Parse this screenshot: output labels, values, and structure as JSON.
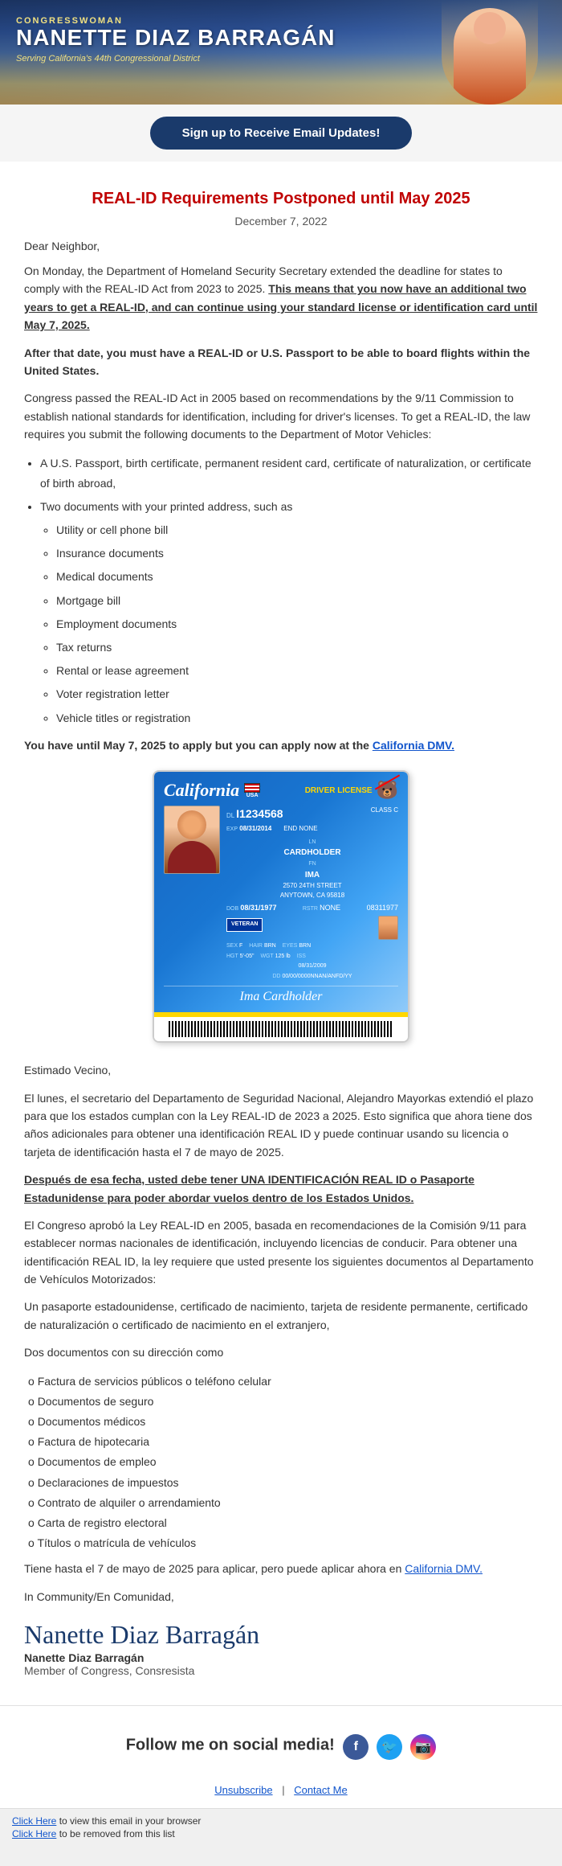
{
  "header": {
    "congresswoman_label": "CONGRESSWOMAN",
    "name": "NANETTE DIAZ BARRAGÁN",
    "district": "Serving California's 44th Congressional District"
  },
  "signup": {
    "button_label": "Sign up to Receive Email Updates!"
  },
  "article": {
    "title": "REAL-ID Requirements Postponed until May 2025",
    "date": "December 7, 2022",
    "greeting": "Dear Neighbor,",
    "para1": "On Monday,  the Department of Homeland Security Secretary extended the deadline for states to comply with the REAL-ID Act from 2023 to 2025.",
    "para1_strong": "This means that you now have an additional two years to get a REAL-ID, and can continue using your standard license or identification card until May 7, 2025.",
    "para2_bold": "After that date, you must have a REAL-ID or U.S. Passport to be able to board flights within the United States.",
    "para3": "Congress passed the REAL-ID Act in 2005 based on recommendations by the 9/11 Commission to establish national standards for identification, including for driver's licenses. To get a REAL-ID, the law requires you submit the following documents to the Department of Motor Vehicles:",
    "list1_item1": "A U.S. Passport, birth certificate, permanent resident card, certificate of naturalization, or certificate of birth abroad,",
    "list1_item2": "Two documents with your printed address, such as",
    "sublist": [
      "Utility or cell phone bill",
      "Insurance documents",
      "Medical documents",
      "Mortgage bill",
      "Employment documents",
      "Tax returns",
      "Rental or lease agreement",
      "Voter registration letter",
      "Vehicle titles or registration"
    ],
    "dmv_text_before": "You have until May 7, 2025 to apply but you can apply now at the ",
    "dmv_link_text": "California DMV.",
    "dmv_link_url": "#"
  },
  "id_card": {
    "state": "California",
    "country": "USA",
    "type": "DRIVER LICENSE",
    "dl_label": "DL",
    "dl_number": "I1234568",
    "class_label": "CLASS C",
    "exp_label": "EXP",
    "exp_date": "08/31/2014",
    "end_none": "END NONE",
    "ln_label": "LN",
    "ln_value": "CARDHOLDER",
    "fn_label": "FN",
    "fn_value": "IMA",
    "address": "2570 24TH STREET",
    "city": "ANYTOWN, CA 95818",
    "dob_label": "DOB",
    "dob_value": "08/31/1977",
    "rstr_label": "RSTR",
    "rstr_value": "NONE",
    "barcode_number": "08311977",
    "veteran_badge": "VETERAN",
    "sex_label": "SEX",
    "sex_value": "F",
    "hair_label": "HAIR",
    "hair_value": "BRN",
    "eyes_label": "EYES",
    "eyes_value": "BRN",
    "hgt_label": "HGT",
    "hgt_value": "5'-05\"",
    "wgt_label": "WGT",
    "wgt_value": "125 lb",
    "iss_label": "ISS",
    "iss_value": "08/31/2009",
    "dd_label": "DD",
    "dd_value": "00/00/0000NNAN/ANFD/YY",
    "signature": "Ima Cardholder"
  },
  "spanish": {
    "greeting": "Estimado Vecino,",
    "para1": "El lunes, el secretario del Departamento de Seguridad Nacional, Alejandro Mayorkas extendió el plazo para que los estados cumplan con la Ley REAL-ID de 2023 a 2025. Esto significa que ahora tiene dos años adicionales para obtener una identificación REAL ID y puede continuar usando su licencia o tarjeta de identificación hasta el 7 de mayo de 2025.",
    "para2_bold": "Después de esa fecha, usted debe tener UNA IDENTIFICACIÓN REAL ID o Pasaporte Estadunidense para poder abordar vuelos dentro de los Estados Unidos.",
    "para3": "El Congreso aprobó la Ley REAL-ID en 2005, basada en recomendaciones de la Comisión 9/11 para establecer normas nacionales de identificación, incluyendo licencias de conducir. Para obtener una identificación REAL ID, la ley requiere que usted presente los siguientes documentos al Departamento de Vehículos Motorizados:",
    "para4": "Un pasaporte estadounidense, certificado de nacimiento, tarjeta de residente permanente, certificado de naturalización o certificado de nacimiento en el extranjero,",
    "para5": "Dos documentos con su dirección como",
    "spanish_list": [
      "Factura de servicios públicos o teléfono celular",
      "Documentos de seguro",
      "Documentos médicos",
      "Factura de hipotecaria",
      "Documentos de empleo",
      "Declaraciones de impuestos",
      "Contrato de alquiler o arrendamiento",
      "Carta de registro electoral",
      "Títulos o matrícula de vehículos"
    ],
    "dmv_text_before": "Tiene hasta el 7 de mayo de 2025 para aplicar, pero puede aplicar ahora en ",
    "dmv_link_text": "California DMV.",
    "closing": "In Community/En Comunidad,"
  },
  "signature": {
    "script": "Nanette Diaz Barragán",
    "name": "Nanette Diaz Barragán",
    "title": "Member of Congress, Consresista"
  },
  "social": {
    "label": "Follow me on social media!",
    "facebook_label": "f",
    "twitter_label": "🐦",
    "instagram_label": "📷"
  },
  "footer": {
    "unsubscribe_label": "Unsubscribe",
    "contact_label": "Contact Me",
    "view_browser_text": "Click Here",
    "view_browser_label": "to view this email in your browser",
    "remove_text": "Click Here",
    "remove_label": "to be removed from this list"
  }
}
